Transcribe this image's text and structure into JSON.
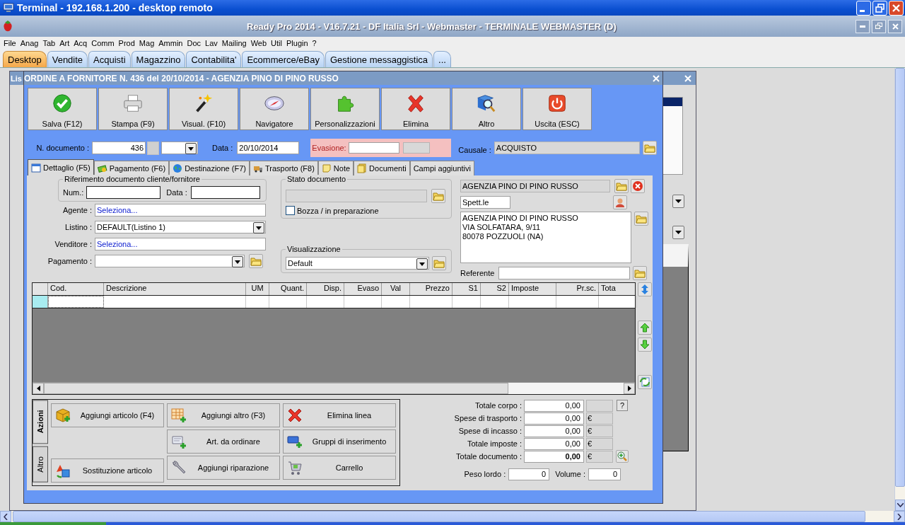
{
  "window": {
    "title": "Terminal - 192.168.1.200 - desktop remoto"
  },
  "app": {
    "title": "Ready Pro 2014 - V16.7.21 - DF Italia Srl - Webmaster - TERMINALE WEBMASTER (D)"
  },
  "menu": [
    {
      "label": "File"
    },
    {
      "label": "Anag"
    },
    {
      "label": "Tab"
    },
    {
      "label": "Art"
    },
    {
      "label": "Acq"
    },
    {
      "label": "Comm"
    },
    {
      "label": "Prod"
    },
    {
      "label": "Mag"
    },
    {
      "label": "Ammin"
    },
    {
      "label": "Doc"
    },
    {
      "label": "Lav"
    },
    {
      "label": "Mailing"
    },
    {
      "label": "Web"
    },
    {
      "label": "Util"
    },
    {
      "label": "Plugin"
    },
    {
      "label": "?"
    }
  ],
  "tabs": [
    {
      "label": "Desktop",
      "selected": true
    },
    {
      "label": "Vendite",
      "selected": false
    },
    {
      "label": "Acquisti",
      "selected": false
    },
    {
      "label": "Magazzino",
      "selected": false
    },
    {
      "label": "Contabilita'",
      "selected": false
    },
    {
      "label": "Ecommerce/eBay",
      "selected": false
    },
    {
      "label": "Gestione messaggistica",
      "selected": false
    },
    {
      "label": "...",
      "selected": false
    }
  ],
  "back_window": {
    "title": "Lis"
  },
  "dialog": {
    "title": "ORDINE A FORNITORE N. 436 del 20/10/2014 - AGENZIA PINO DI PINO RUSSO",
    "toolbar": [
      {
        "label": "Salva (F12)",
        "kind": "check"
      },
      {
        "label": "Stampa (F9)",
        "kind": "printer"
      },
      {
        "label": "Visual. (F10)",
        "kind": "wand"
      },
      {
        "label": "Navigatore",
        "kind": "compass"
      },
      {
        "label": "Personalizzazioni",
        "kind": "puzzle"
      },
      {
        "label": "Elimina",
        "kind": "cross"
      },
      {
        "label": "Altro",
        "kind": "book"
      },
      {
        "label": "Uscita (ESC)",
        "kind": "power"
      }
    ],
    "header": {
      "number_label": "N. documento :",
      "number": "436",
      "date_label": "Data :",
      "date": "20/10/2014",
      "evasion_label": "Evasione:",
      "causale_label": "Causale :",
      "causale": "ACQUISTO"
    },
    "tabs": [
      {
        "label": "Dettaglio (F5)",
        "kind": "calendar",
        "selected": true
      },
      {
        "label": "Pagamento (F6)",
        "kind": "money",
        "selected": false
      },
      {
        "label": "Destinazione (F7)",
        "kind": "globe",
        "selected": false
      },
      {
        "label": "Trasporto (F8)",
        "kind": "truck",
        "selected": false
      },
      {
        "label": "Note",
        "kind": "note",
        "selected": false
      },
      {
        "label": "Documenti",
        "kind": "docs",
        "selected": false
      },
      {
        "label": "Campi aggiuntivi",
        "kind": "none",
        "selected": false
      }
    ],
    "reference": {
      "title": "Riferimento documento cliente/fornitore",
      "num_label": "Num.:",
      "date_label": "Data :"
    },
    "fields": [
      {
        "label": "Agente :",
        "value": "Seleziona...",
        "kind": "link"
      },
      {
        "label": "Listino :",
        "value": "DEFAULT(Listino 1)",
        "kind": "combo"
      },
      {
        "label": "Venditore :",
        "value": "Seleziona...",
        "kind": "link"
      },
      {
        "label": "Pagamento :",
        "kind": "combo-folder"
      }
    ],
    "status": {
      "title": "Stato documento",
      "draft_label": "Bozza / in preparazione",
      "draft_checked": false
    },
    "view": {
      "title": "Visualizzazione",
      "value": "Default"
    },
    "supplier": {
      "name": "AGENZIA PINO DI PINO RUSSO",
      "salutation": "Spett.le",
      "address": [
        "AGENZIA PINO DI PINO RUSSO",
        "VIA SOLFATARA, 9/11",
        "80078 POZZUOLI (NA)"
      ],
      "contact_label": "Referente"
    },
    "grid": {
      "columns": [
        {
          "label": "Cod.",
          "kind": "text"
        },
        {
          "label": "Descrizione",
          "kind": "text"
        },
        {
          "label": "UM",
          "kind": "center"
        },
        {
          "label": "Quant.",
          "kind": "number"
        },
        {
          "label": "Disp.",
          "kind": "number"
        },
        {
          "label": "Evaso",
          "kind": "number"
        },
        {
          "label": "Val",
          "kind": "center"
        },
        {
          "label": "Prezzo",
          "kind": "number"
        },
        {
          "label": "S1",
          "kind": "number"
        },
        {
          "label": "S2",
          "kind": "number"
        },
        {
          "label": "Imposte",
          "kind": "text"
        },
        {
          "label": "Pr.sc.",
          "kind": "number"
        },
        {
          "label": "Tota",
          "kind": "text"
        }
      ],
      "rows": [
        {
          "selected": true
        }
      ]
    },
    "actions": {
      "tabs": [
        {
          "label": "Azioni",
          "selected": true
        },
        {
          "label": "Altro",
          "selected": false
        }
      ],
      "columns": [
        [
          {
            "label": "Aggiungi articolo (F4)",
            "kind": "box"
          },
          {
            "label": "Sostituzione articolo",
            "kind": "swap"
          }
        ],
        [
          {
            "label": "Aggiungi altro (F3)",
            "kind": "grid"
          },
          {
            "label": "Art. da ordinare",
            "kind": "scroll"
          },
          {
            "label": "Aggiungi riparazione",
            "kind": "wrench"
          }
        ],
        [
          {
            "label": "Elimina linea",
            "kind": "cross"
          },
          {
            "label": "Gruppi di inserimento",
            "kind": "card"
          },
          {
            "label": "Carrello",
            "kind": "cart"
          }
        ]
      ]
    },
    "totals": [
      {
        "label": "Totale corpo :",
        "value": "0,00",
        "kind": "help"
      },
      {
        "label": "Spese di trasporto :",
        "value": "0,00",
        "currency": "€",
        "kind": "plain"
      },
      {
        "label": "Spese di incasso :",
        "value": "0,00",
        "currency": "€",
        "kind": "plain"
      },
      {
        "label": "Totale imposte :",
        "value": "0,00",
        "currency": "€",
        "kind": "plain"
      },
      {
        "label": "Totale documento :",
        "value": "0,00",
        "currency": "€",
        "kind": "grand"
      }
    ],
    "help_button": "?",
    "weight_label": "Peso lordo :",
    "weight": "0",
    "volume_label": "Volume :",
    "volume": "0"
  }
}
